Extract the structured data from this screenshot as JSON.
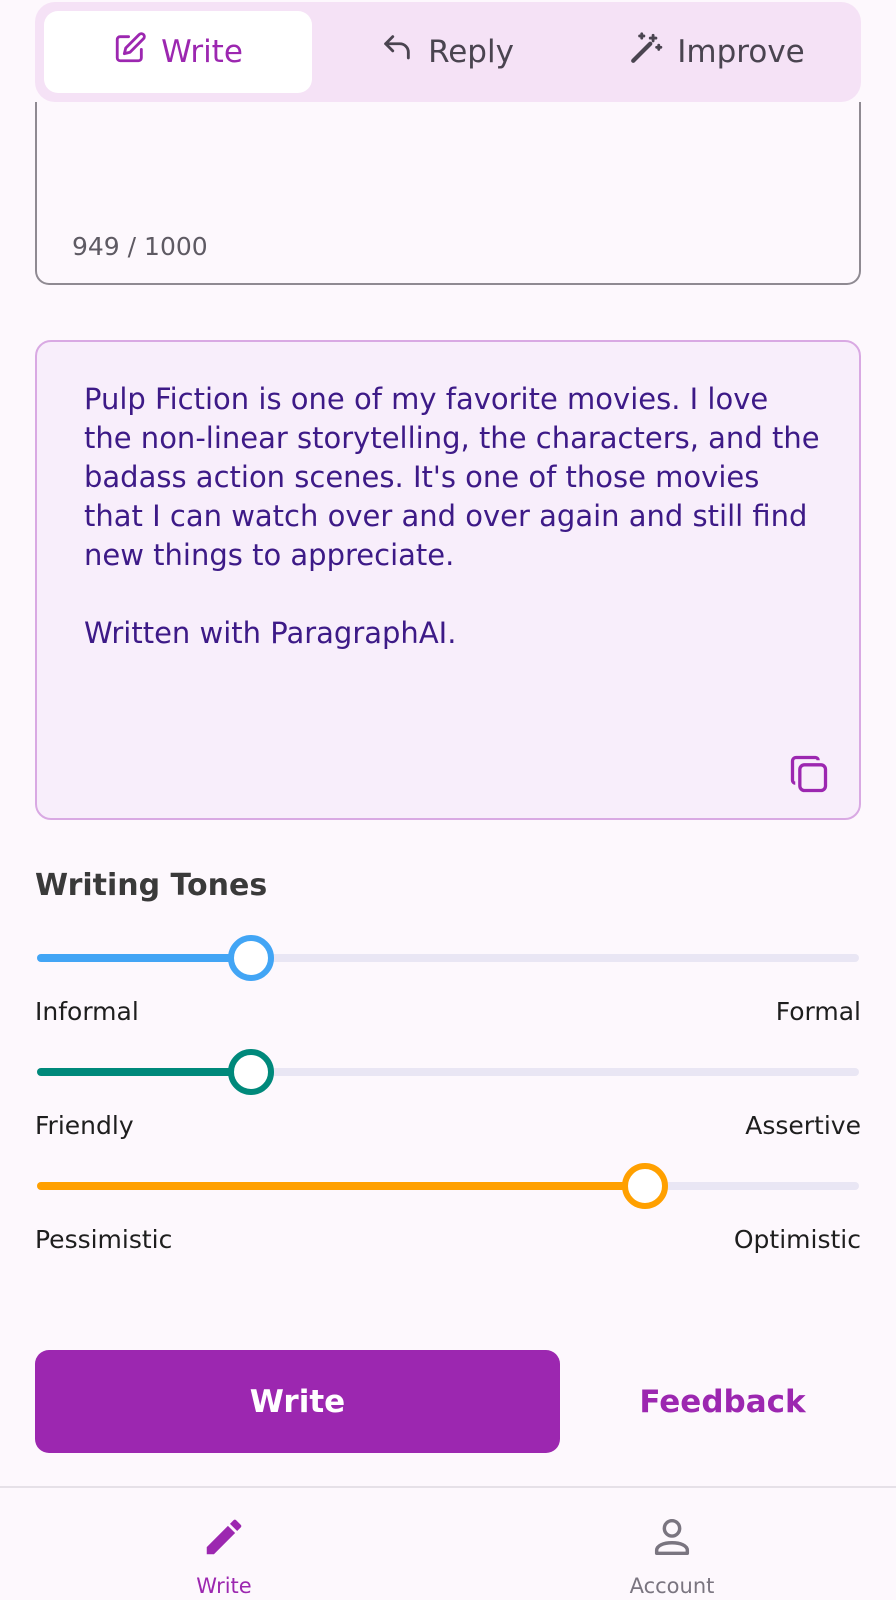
{
  "mode_tabs": [
    {
      "label": "Write",
      "icon": "edit-icon",
      "active": true
    },
    {
      "label": "Reply",
      "icon": "reply-icon",
      "active": false
    },
    {
      "label": "Improve",
      "icon": "magic-wand-icon",
      "active": false
    }
  ],
  "input": {
    "char_count": "949 / 1000"
  },
  "output": {
    "text": "Pulp Fiction is one of my favorite movies. I love the non-linear storytelling, the characters, and the badass action scenes. It's one of those movies that I can watch over and over again and still find new things to appreciate.\n\nWritten with ParagraphAI.",
    "copy_icon": "copy-icon"
  },
  "tones": {
    "title": "Writing Tones",
    "sliders": [
      {
        "left_label": "Informal",
        "right_label": "Formal",
        "value": 0.26,
        "color": "#42a5f5"
      },
      {
        "left_label": "Friendly",
        "right_label": "Assertive",
        "value": 0.26,
        "color": "#00897b"
      },
      {
        "left_label": "Pessimistic",
        "right_label": "Optimistic",
        "value": 0.74,
        "color": "#ffa000"
      }
    ]
  },
  "actions": {
    "write_label": "Write",
    "feedback_label": "Feedback"
  },
  "bottom_nav": [
    {
      "label": "Write",
      "icon": "pencil-icon",
      "active": true
    },
    {
      "label": "Account",
      "icon": "person-icon",
      "active": false
    }
  ],
  "colors": {
    "accent": "#9c27b0",
    "output_text": "#3d1a87",
    "tab_background": "#f5e2f6"
  }
}
